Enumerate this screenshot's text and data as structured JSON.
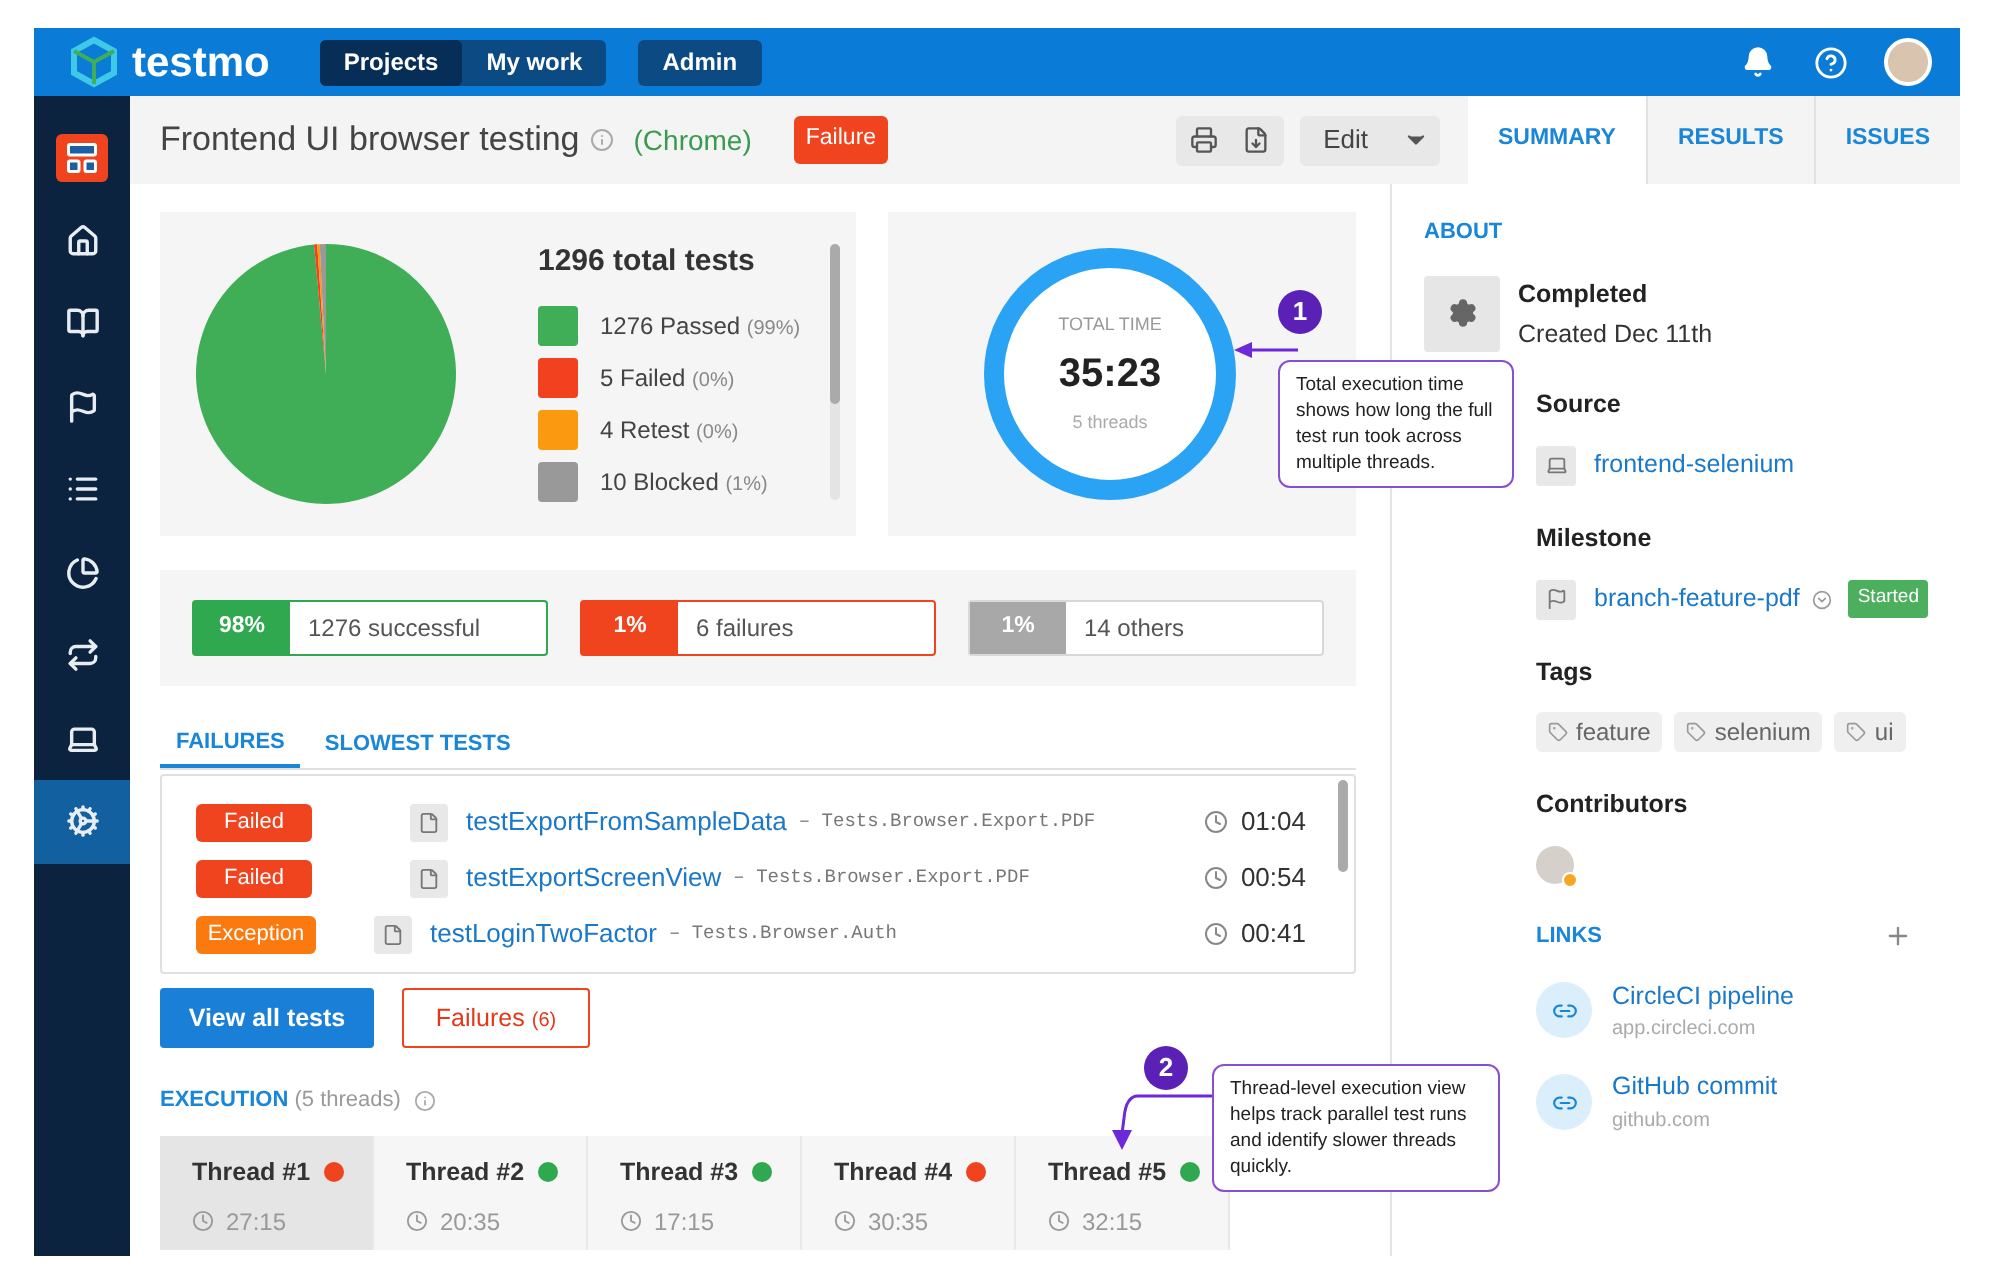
{
  "topbar": {
    "logo": "testmo",
    "nav": [
      {
        "label": "Projects",
        "selected": true
      },
      {
        "label": "My work",
        "selected": false
      }
    ],
    "admin": "Admin"
  },
  "sidebar": [
    {
      "selected": false
    },
    {
      "selected": false
    },
    {
      "selected": false
    },
    {
      "selected": false
    },
    {
      "selected": false
    },
    {
      "selected": false
    },
    {
      "selected": false
    },
    {
      "selected": false
    },
    {
      "selected": true
    }
  ],
  "header": {
    "title": "Frontend UI browser testing",
    "browser": "(Chrome)",
    "status": "Failure",
    "edit": "Edit"
  },
  "tabs": [
    {
      "label": "SUMMARY",
      "selected": true
    },
    {
      "label": "RESULTS",
      "selected": false
    },
    {
      "label": "ISSUES",
      "selected": false
    }
  ],
  "stats": {
    "total": "1296 total tests",
    "legend": [
      {
        "label": "1276 Passed",
        "pct": "(99%)",
        "color": "#3fae57"
      },
      {
        "label": "5 Failed",
        "pct": "(0%)",
        "color": "#f2411f"
      },
      {
        "label": "4 Retest",
        "pct": "(0%)",
        "color": "#fb9a10"
      },
      {
        "label": "10 Blocked",
        "pct": "(1%)",
        "color": "#999999"
      }
    ],
    "chart_data": {
      "type": "pie",
      "values": [
        98.53,
        0.39,
        0.31,
        0.77
      ]
    }
  },
  "time": {
    "label": "TOTAL TIME",
    "value": "35:23",
    "sub": "5 threads"
  },
  "summary": [
    {
      "kind": "success",
      "pct": "98%",
      "label": "1276 successful"
    },
    {
      "kind": "failure",
      "pct": "1%",
      "label": "6 failures"
    },
    {
      "kind": "other",
      "pct": "1%",
      "label": "14 others"
    }
  ],
  "list_tabs": [
    {
      "label": "FAILURES",
      "selected": true
    },
    {
      "label": "SLOWEST TESTS",
      "selected": false
    }
  ],
  "failures": [
    {
      "kind": "failed",
      "status": "Failed",
      "name": "testExportFromSampleData",
      "path": "– Tests.Browser.Export.PDF",
      "time": "01:04"
    },
    {
      "kind": "failed",
      "status": "Failed",
      "name": "testExportScreenView",
      "path": "– Tests.Browser.Export.PDF",
      "time": "00:54"
    },
    {
      "kind": "exception",
      "status": "Exception",
      "name": "testLoginTwoFactor",
      "path": "– Tests.Browser.Auth",
      "time": "00:41"
    }
  ],
  "buttons": {
    "view_all": "View all tests",
    "failures": "Failures",
    "failures_count": "(6)"
  },
  "execution": {
    "title": "EXECUTION",
    "sub": "(5 threads)",
    "threads": [
      {
        "name": "Thread #1",
        "time": "27:15",
        "color": "#f0441f",
        "selected": true
      },
      {
        "name": "Thread #2",
        "time": "20:35",
        "color": "#2fa84f",
        "selected": false
      },
      {
        "name": "Thread #3",
        "time": "17:15",
        "color": "#2fa84f",
        "selected": false
      },
      {
        "name": "Thread #4",
        "time": "30:35",
        "color": "#f0441f",
        "selected": false
      },
      {
        "name": "Thread #5",
        "time": "32:15",
        "color": "#2fa84f",
        "selected": false
      }
    ]
  },
  "callouts": [
    {
      "number": "1",
      "text": "Total execution time shows how long the full test run took across multiple threads."
    },
    {
      "number": "2",
      "text": "Thread-level execution view helps track parallel test runs and identify slower threads quickly."
    }
  ],
  "about": {
    "title": "ABOUT",
    "state": "Completed",
    "created": "Created Dec 11th",
    "source_title": "Source",
    "source": "frontend-selenium",
    "milestone_title": "Milestone",
    "milestone": "branch-feature-pdf",
    "milestone_status": "Started",
    "tags_title": "Tags",
    "tags": [
      "feature",
      "selenium",
      "ui"
    ],
    "contributors_title": "Contributors"
  },
  "links": {
    "title": "LINKS",
    "items": [
      {
        "name": "CircleCI pipeline",
        "url": "app.circleci.com"
      },
      {
        "name": "GitHub commit",
        "url": "github.com"
      }
    ]
  }
}
